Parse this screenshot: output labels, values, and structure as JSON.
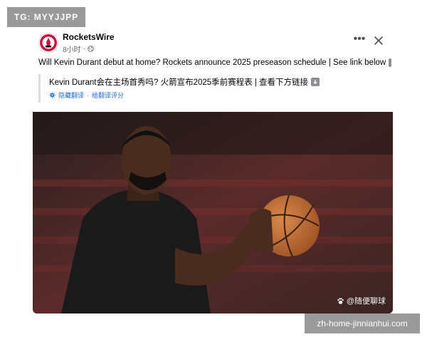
{
  "watermarks": {
    "top_left": "TG: MYYJJPP",
    "bottom_right": "zh-home-jinnianhui.com"
  },
  "post": {
    "page_name": "RocketsWire",
    "time_ago": "8小时",
    "dot": "·",
    "audience_icon": "globe-icon",
    "more_label": "•••",
    "text": "Will Kevin Durant debut at home? Rockets announce 2025 preseason schedule | See link below",
    "translation": {
      "text": "Kevin Durant会在主场首秀吗? 火箭宣布2025季前赛程表 | 查看下方链接",
      "hide_label": "隐藏翻译",
      "separator": "·",
      "rate_label": "给翻译评分"
    },
    "photo": {
      "description_icon": "player-photo",
      "credit": "@随便聊球"
    }
  },
  "colors": {
    "accent_link": "#216fdb",
    "meta_gray": "#65676b",
    "watermark_gray": "#9a9a9a",
    "rockets_red": "#ce1141"
  }
}
